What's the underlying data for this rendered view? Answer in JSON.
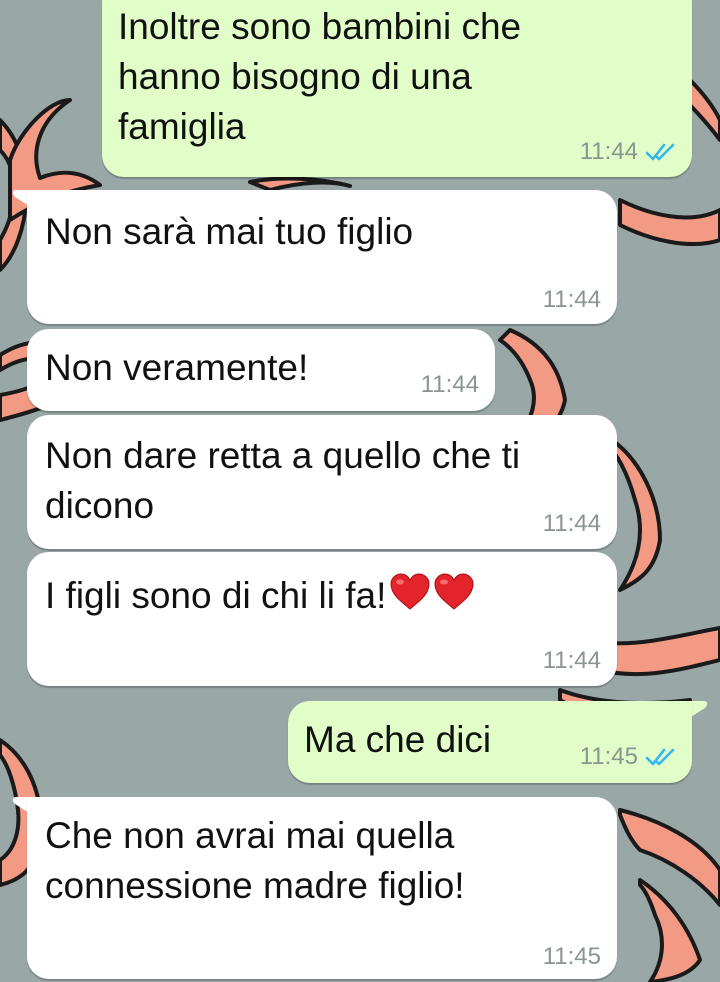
{
  "messages": [
    {
      "direction": "outgoing",
      "text_lines": [
        "Inoltre sono bambini che",
        "hanno bisogno di una",
        "famiglia"
      ],
      "time": "11:44",
      "status_icon": "double-check-read-icon"
    },
    {
      "direction": "incoming",
      "text_lines": [
        "Non sarà mai tuo figlio"
      ],
      "time": "11:44"
    },
    {
      "direction": "incoming",
      "text_lines": [
        "Non veramente!"
      ],
      "time": "11:44"
    },
    {
      "direction": "incoming",
      "text_lines": [
        "Non dare retta a quello che ti",
        "dicono"
      ],
      "time": "11:44"
    },
    {
      "direction": "incoming",
      "text_lines": [
        "I figli sono di chi li fa!"
      ],
      "emoji": [
        "red-heart-icon",
        "red-heart-icon"
      ],
      "time": "11:44"
    },
    {
      "direction": "outgoing",
      "text_lines": [
        "Ma che dici"
      ],
      "time": "11:45",
      "status_icon": "double-check-read-icon"
    },
    {
      "direction": "incoming",
      "text_lines": [
        "Che non avrai mai quella",
        "connessione madre figlio!"
      ],
      "time": "11:45"
    }
  ],
  "colors": {
    "wallpaper": "#9aa7a7",
    "incoming_bubble": "#ffffff",
    "outgoing_bubble": "#e1fdc8",
    "read_ticks": "#34b7f1",
    "heart": "#e3242b",
    "wallpaper_flame": "#f39a85"
  }
}
